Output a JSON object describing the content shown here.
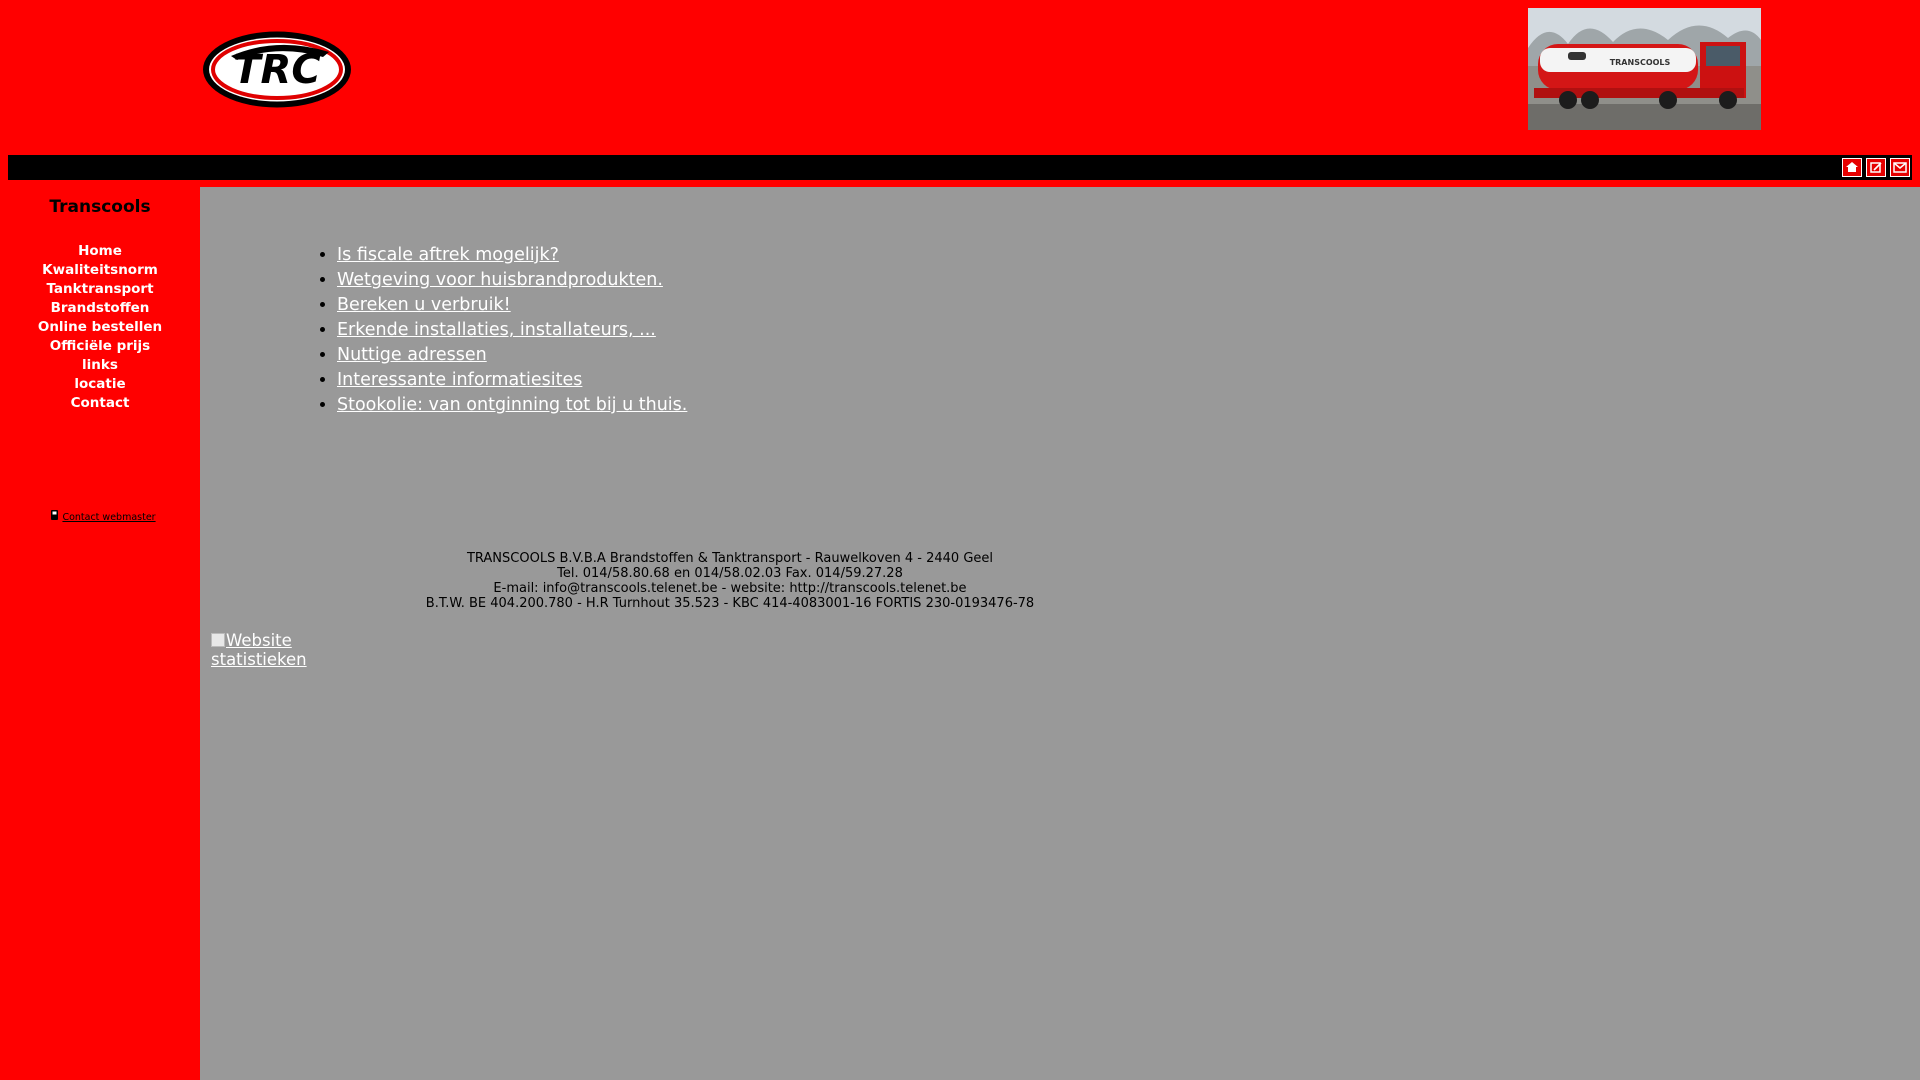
{
  "header": {
    "logo_text": "TRC",
    "truck_text": "TRANSCOOLS"
  },
  "topbar": {
    "icons": [
      "home-icon",
      "edit-icon",
      "mail-icon"
    ]
  },
  "sidebar": {
    "brand": "Transcools",
    "items": [
      {
        "label": "Home"
      },
      {
        "label": "Kwaliteitsnorm"
      },
      {
        "label": "Tanktransport"
      },
      {
        "label": "Brandstoffen"
      },
      {
        "label": "Online bestellen"
      },
      {
        "label": "Officiële prijs"
      },
      {
        "label": "links"
      },
      {
        "label": "locatie"
      },
      {
        "label": "Contact"
      }
    ],
    "webmaster_label": "Contact webmaster"
  },
  "content": {
    "links": [
      {
        "label": "Is fiscale aftrek mogelijk?"
      },
      {
        "label": "Wetgeving voor huisbrandprodukten."
      },
      {
        "label": "Bereken u verbruik!"
      },
      {
        "label": "Erkende installaties, installateurs, ..."
      },
      {
        "label": "Nuttige adressen"
      },
      {
        "label": "Interessante informatiesites"
      },
      {
        "label": "Stookolie: van ontginning tot bij u thuis."
      }
    ],
    "footer": {
      "line1": "TRANSCOOLS B.V.B.A Brandstoffen & Tanktransport - Rauwelkoven 4 - 2440 Geel",
      "line2": "Tel. 014/58.80.68 en 014/58.02.03 Fax. 014/59.27.28",
      "line3": "E-mail: info@transcools.telenet.be - website: http://transcools.telenet.be",
      "line4": "B.T.W. BE 404.200.780 - H.R Turnhout 35.523 - KBC 414-4083001-16 FORTIS 230-0193476-78"
    },
    "stats_line1": "Website",
    "stats_line2": "statistieken"
  },
  "colors": {
    "page_red": "#ff0000",
    "content_gray": "#999999",
    "bar_black": "#000000",
    "link_white": "#ffffff"
  }
}
